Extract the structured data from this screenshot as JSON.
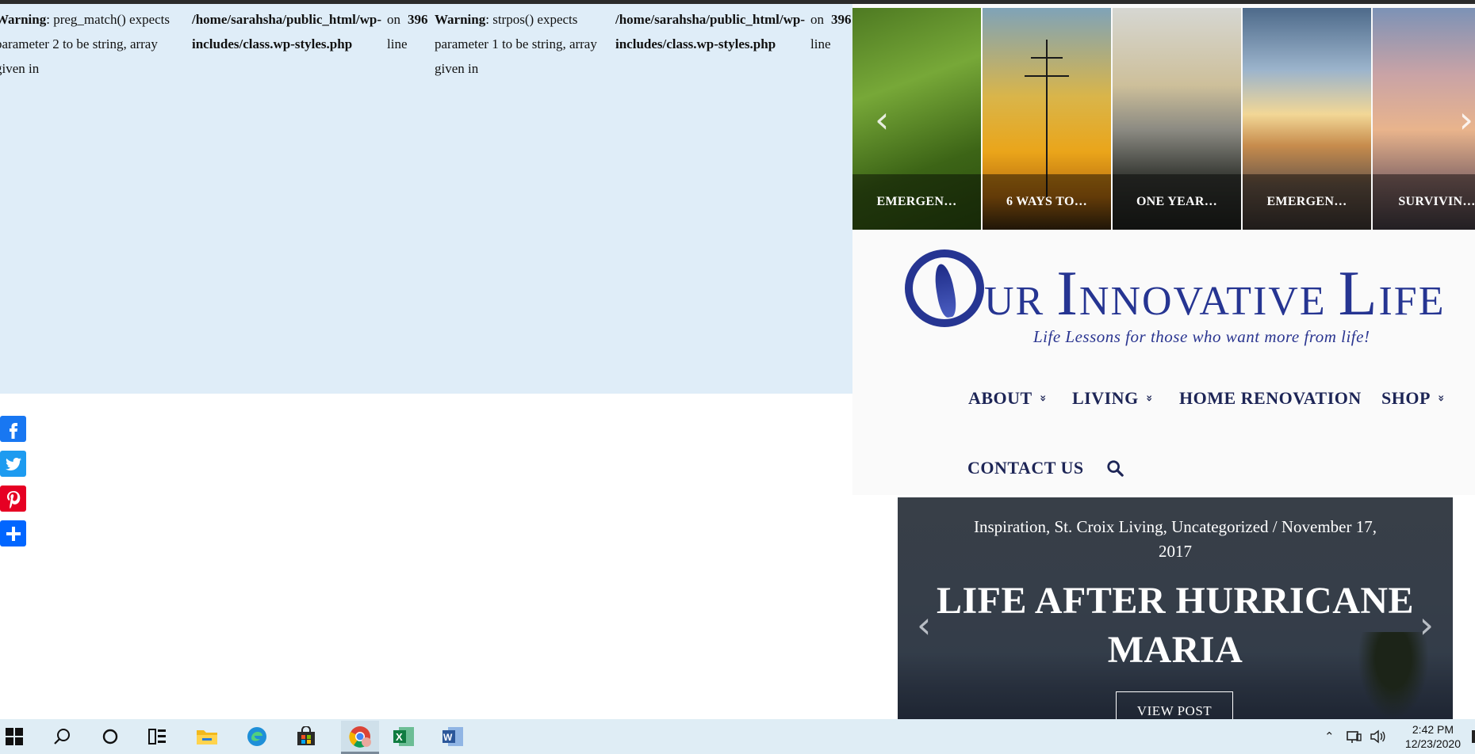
{
  "warnings": [
    {
      "label": "Warning",
      "text": ": preg_match() expects parameter 2 to be string, array given in"
    },
    {
      "path": "/home/sarahsha/public_html/wp-includes/class.wp-styles.php"
    },
    {
      "on": "on line"
    },
    {
      "line": "396"
    },
    {
      "label": "Warning",
      "text": ": strpos() expects parameter 1 to be string, array given in"
    },
    {
      "path": "/home/sarahsha/public_html/wp-includes/class.wp-styles.php"
    },
    {
      "on": "on line"
    },
    {
      "line": "396"
    }
  ],
  "social": {
    "facebook": "facebook-icon",
    "twitter": "twitter-icon",
    "pinterest": "pinterest-icon",
    "share": "plus-icon"
  },
  "carousel": {
    "items": [
      {
        "caption": "EMERGEN…"
      },
      {
        "caption": "6 WAYS TO…"
      },
      {
        "caption": "ONE YEAR…"
      },
      {
        "caption": "EMERGEN…"
      },
      {
        "caption": "SURVIVIN…"
      }
    ]
  },
  "logo": {
    "text_parts": [
      "UR ",
      "I",
      "NNOVATIVE ",
      "L",
      "IFE"
    ],
    "tagline": "Life Lessons for those who want more from life!"
  },
  "nav": {
    "items": [
      {
        "label": "ABOUT",
        "has_dropdown": true
      },
      {
        "label": "LIVING",
        "has_dropdown": true
      },
      {
        "label": "HOME RENOVATION",
        "has_dropdown": false
      },
      {
        "label": "SHOP",
        "has_dropdown": true
      },
      {
        "label": "CONTACT US",
        "has_dropdown": false
      }
    ],
    "chevron": "»"
  },
  "hero": {
    "meta": "Inspiration, St. Croix Living, Uncategorized / November 17, 2017",
    "title": "LIFE AFTER HURRICANE MARIA",
    "button": "VIEW POST"
  },
  "taskbar": {
    "time": "2:42 PM",
    "date": "12/23/2020"
  },
  "colors": {
    "warning_bg": "#dfedf8",
    "logo_blue": "#263592",
    "nav_text": "#1d2556",
    "taskbar_bg": "#dfedf5"
  }
}
